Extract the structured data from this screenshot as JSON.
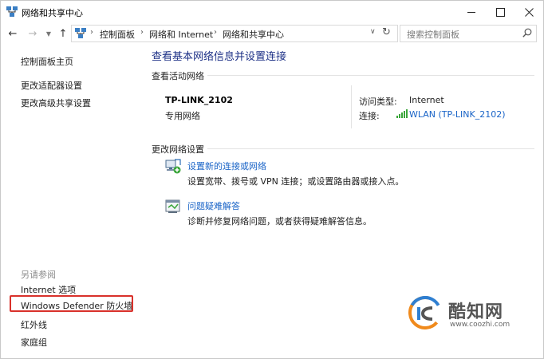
{
  "window": {
    "title": "网络和共享中心"
  },
  "address_bar": {
    "crumbs": [
      "控制面板",
      "网络和 Internet",
      "网络和共享中心"
    ],
    "search_placeholder": "搜索控制面板"
  },
  "sidebar": {
    "links": [
      "控制面板主页",
      "更改适配器设置",
      "更改高级共享设置"
    ],
    "see_also_heading": "另请参阅",
    "see_also": [
      "Internet 选项",
      "Windows Defender 防火墙",
      "红外线",
      "家庭组"
    ]
  },
  "main": {
    "title": "查看基本网络信息并设置连接",
    "active_heading": "查看活动网络",
    "network": {
      "name": "TP-LINK_2102",
      "type": "专用网络",
      "access_label": "访问类型:",
      "access_value": "Internet",
      "conn_label": "连接:",
      "conn_value": "WLAN (TP-LINK_2102)"
    },
    "change_heading": "更改网络设置",
    "tasks": [
      {
        "link": "设置新的连接或网络",
        "desc": "设置宽带、拨号或 VPN 连接；或设置路由器或接入点。"
      },
      {
        "link": "问题疑难解答",
        "desc": "诊断并修复网络问题，或者获得疑难解答信息。"
      }
    ]
  },
  "watermark": {
    "name": "酷知网",
    "url": "www.coozhi.com"
  },
  "colors": {
    "link": "#1a64c7",
    "title": "#1e3287",
    "highlight": "#d9312b"
  }
}
